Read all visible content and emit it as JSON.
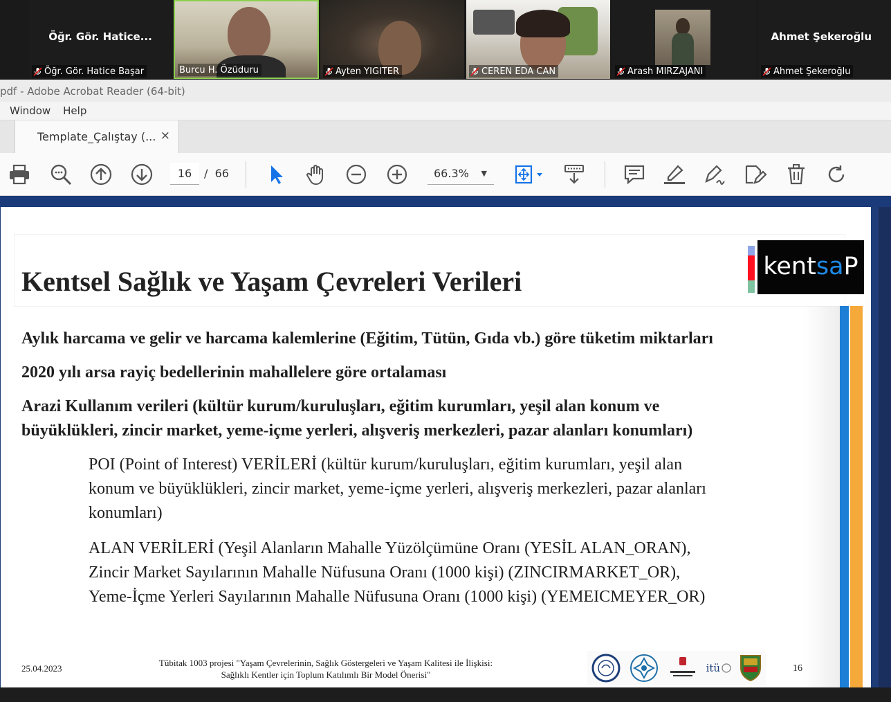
{
  "participants": [
    {
      "display": "Öğr. Gör. Hatice...",
      "name": "Öğr. Gör. Hatice Başar",
      "video": false
    },
    {
      "name": "Burcu H. Özüduru",
      "video": true
    },
    {
      "name": "Ayten YIGITER",
      "video": true
    },
    {
      "name": "CEREN EDA CAN",
      "video": true
    },
    {
      "name": "Arash MIRZAJANI",
      "video": false
    },
    {
      "display": "Ahmet Şekeroğlu",
      "name": "Ahmet Şekeroğlu",
      "video": false
    }
  ],
  "window": {
    "title": "pdf - Adobe Acrobat Reader (64-bit)"
  },
  "menu": [
    "Window",
    "Help"
  ],
  "tab": {
    "label": "Template_Çalıştay (...",
    "close": "×"
  },
  "toolbar": {
    "current_page": "16",
    "page_separator": "/",
    "total_pages": "66",
    "zoom": "66.3%",
    "icons": [
      "print-icon",
      "zoom-out-magnifier-icon",
      "page-up-icon",
      "page-down-icon",
      "select-cursor-icon",
      "hand-tool-icon",
      "zoom-out-icon",
      "zoom-in-icon",
      "fit-page-icon",
      "scroll-mode-icon",
      "comment-icon",
      "highlight-icon",
      "sign-icon",
      "fill-sign-icon",
      "delete-icon",
      "rotate-icon"
    ]
  },
  "slide": {
    "title": "Kentsel Sağlık ve Yaşam Çevreleri Verileri",
    "logo_text_a": "kent",
    "logo_text_b": "sa",
    "logo_text_c": "P",
    "bold_lines": [
      "Aylık harcama ve gelir ve harcama kalemlerine (Eğitim, Tütün, Gıda vb.) göre tüketim miktarları",
      "2020 yılı arsa rayiç bedellerinin mahallelere göre ortalaması",
      "Arazi Kullanım verileri (kültür kurum/kuruluşları, eğitim kurumları, yeşil alan konum ve",
      "büyüklükleri, zincir market, yeme-içme yerleri, alışveriş merkezleri, pazar alanları konumları)"
    ],
    "poi_lines": [
      "POI (Point of Interest) VERİLERİ (kültür kurum/kuruluşları, eğitim kurumları, yeşil alan",
      "konum ve büyüklükleri, zincir market, yeme-içme yerleri, alışveriş merkezleri,    pazar alanları",
      "konumları)"
    ],
    "alan_lines": [
      "ALAN VERİLERİ (Yeşil Alanların Mahalle Yüzölçümüne Oranı (YESİL ALAN_ORAN),",
      "Zincir Market Sayılarının Mahalle Nüfusuna Oranı (1000 kişi) (ZINCIRMARKET_OR),",
      "Yeme-İçme Yerleri Sayılarının Mahalle Nüfusuna Oranı (1000 kişi) (YEMEICMEYER_OR)"
    ],
    "footer_date": "25.04.2023",
    "footer_project_1": "Tübitak 1003 projesi \"Yaşam Çevrelerinin, Sağlık Göstergeleri ve Yaşam Kalitesi ile İlişkisi:",
    "footer_project_2": "Sağlıklı Kentler için Toplum Katılımlı Bir Model Önerisi\"",
    "footer_page": "16",
    "footer_logo_itu": "itü"
  }
}
